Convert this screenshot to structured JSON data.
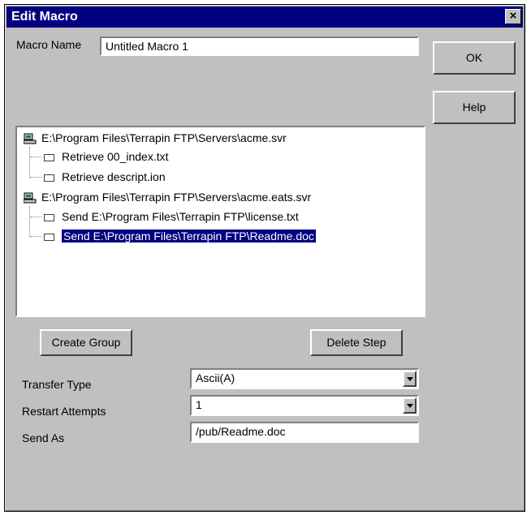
{
  "window": {
    "title": "Edit Macro",
    "close_label": "×"
  },
  "macro_name": {
    "label": "Macro Name",
    "value": "Untitled Macro 1"
  },
  "buttons": {
    "ok": "OK",
    "help": "Help",
    "create_group": "Create Group",
    "delete_step": "Delete Step"
  },
  "tree": {
    "groups": [
      {
        "server": "E:\\Program Files\\Terrapin FTP\\Servers\\acme.svr",
        "steps": [
          "Retrieve 00_index.txt",
          "Retrieve descript.ion"
        ]
      },
      {
        "server": "E:\\Program Files\\Terrapin FTP\\Servers\\acme.eats.svr",
        "steps": [
          "Send E:\\Program Files\\Terrapin FTP\\license.txt",
          "Send E:\\Program Files\\Terrapin FTP\\Readme.doc"
        ]
      }
    ],
    "selected": "Send E:\\Program Files\\Terrapin FTP\\Readme.doc"
  },
  "settings": {
    "transfer_type": {
      "label": "Transfer Type",
      "value": "Ascii(A)"
    },
    "restart_attempts": {
      "label": "Restart Attempts",
      "value": "1"
    },
    "send_as": {
      "label": "Send As",
      "value": "/pub/Readme.doc"
    }
  }
}
